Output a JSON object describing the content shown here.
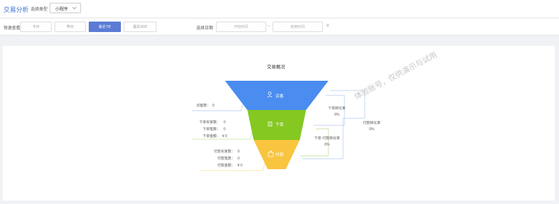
{
  "header": {
    "title": "交易分析",
    "type_label": "选择类型",
    "type_value": "小程序"
  },
  "filters": {
    "quick_label": "快速查看",
    "quick_buttons": [
      "今日",
      "昨日",
      "最近7日",
      "最近30日"
    ],
    "active_quick": "最近7日",
    "date_label": "选择日期",
    "start_placeholder": "开始时间",
    "range_separator": "~",
    "end_placeholder": "结束时间"
  },
  "overview": {
    "title": "交易概况",
    "watermark": "体验账号，仅供演示与试用",
    "stages": [
      {
        "name": "访客",
        "icon": "user-icon",
        "color": "#4a8cf0"
      },
      {
        "name": "下单",
        "icon": "order-icon",
        "color": "#85c822"
      },
      {
        "name": "付款",
        "icon": "wallet-icon",
        "color": "#f9c53f"
      }
    ],
    "visitor_stats": [
      {
        "label": "访客数：",
        "value": "0"
      }
    ],
    "order_stats": [
      {
        "label": "下单买家数：",
        "value": "0"
      },
      {
        "label": "下单笔数：",
        "value": "0"
      },
      {
        "label": "下单金额：",
        "value": "¥ 0"
      }
    ],
    "payment_stats": [
      {
        "label": "付款买家数：",
        "value": "0"
      },
      {
        "label": "付款笔数：",
        "value": "0"
      },
      {
        "label": "付款金额：",
        "value": "¥ 0"
      }
    ],
    "conversions": [
      {
        "label": "下单转化率",
        "value": "0%"
      },
      {
        "label": "下单-付款转化率",
        "value": "0%"
      },
      {
        "label": "付款转化率",
        "value": "0%"
      }
    ]
  }
}
